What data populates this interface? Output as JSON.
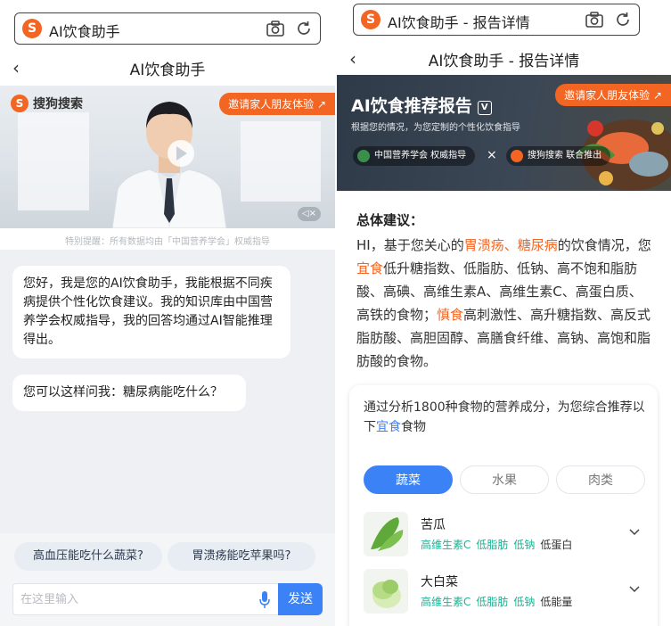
{
  "left": {
    "urlbar": {
      "logo": "S",
      "title": "AI饮食助手"
    },
    "nav": {
      "back": "‹",
      "title": "AI饮食助手"
    },
    "video": {
      "brand": "搜狗搜索",
      "invite": "邀请家人朋友体验 ↗",
      "mute": "◁×",
      "notice": "特别提醒：所有数据均由「中国营养学会」权威指导"
    },
    "chat": {
      "messages": [
        "您好，我是您的AI饮食助手，我能根据不同疾病提供个性化饮食建议。我的知识库由中国营养学会权威指导，我的回答均通过AI智能推理得出。",
        "您可以这样问我：糖尿病能吃什么？"
      ]
    },
    "suggestions": [
      "高血压能吃什么蔬菜?",
      "胃溃疡能吃苹果吗?"
    ],
    "input": {
      "placeholder": "在这里输入",
      "value": ""
    },
    "send_label": "发送"
  },
  "right": {
    "urlbar": {
      "logo": "S",
      "title": "AI饮食助手 - 报告详情"
    },
    "nav": {
      "back": "‹",
      "title": "AI饮食助手 - 报告详情"
    },
    "banner": {
      "title": "AI饮食推荐报告",
      "badge": "V",
      "subtitle": "根据您的情况，为您定制的个性化饮食指导",
      "invite": "邀请家人朋友体验 ↗",
      "tag1": "中国营养学会 权威指导",
      "tag_sep": "×",
      "tag2": "搜狗搜索 联合推出"
    },
    "advice": {
      "heading": "总体建议：",
      "p1_pre": "HI，基于您关心的",
      "p1_disease": "胃溃疡、糖尿病",
      "p1_mid": "的饮食情况，您",
      "p1_good": "宜食",
      "p1_good_text": "低升糖指数、低脂肪、低钠、高不饱和脂肪酸、高碘、高维生素A、高维生素C、高蛋白质、高铁的食物；",
      "p1_bad": "慎食",
      "p1_bad_text": "高刺激性、高升糖指数、高反式脂肪酸、高胆固醇、高膳食纤维、高钠、高饱和脂肪酸的食物。"
    },
    "recommend": {
      "intro_pre": "通过分析1800种食物的营养成分，为您综合推荐以下",
      "intro_hl": "宜食",
      "intro_post": "食物",
      "tabs": [
        "蔬菜",
        "水果",
        "肉类"
      ],
      "active_tab": "蔬菜",
      "foods": [
        {
          "name": "苦瓜",
          "tags_green": [
            "高维生素C",
            "低脂肪",
            "低钠"
          ],
          "tags_plain": [
            "低蛋白"
          ]
        },
        {
          "name": "大白菜",
          "tags_green": [
            "高维生素C",
            "低脂肪",
            "低钠"
          ],
          "tags_plain": [
            "低能量"
          ]
        }
      ]
    }
  },
  "colors": {
    "brand_orange": "#f26522",
    "accent_blue": "#3b82f6",
    "tag_green": "#19b394"
  },
  "icons": [
    "sogou-logo-icon",
    "camera-icon",
    "reload-icon",
    "back-chevron-icon",
    "play-icon",
    "mute-icon",
    "mic-icon",
    "chevron-down-icon",
    "verified-badge-icon"
  ]
}
